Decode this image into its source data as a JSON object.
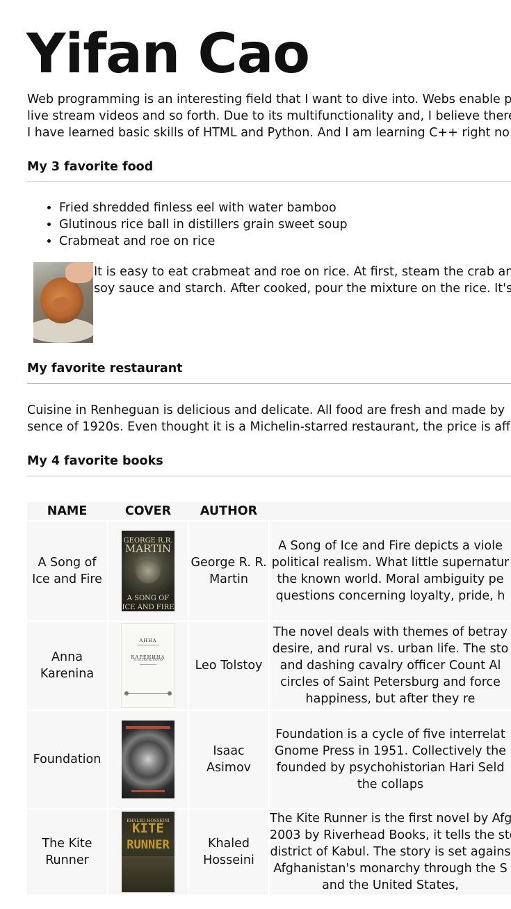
{
  "title": "Yifan Cao",
  "intro": [
    "Web programming is an interesting field that I want to dive into. Webs enable p",
    "live stream videos and so forth. Due to its multifunctionality and, I believe there",
    "I have learned basic skills of HTML and Python. And I am learning C++ right no"
  ],
  "food": {
    "heading": "My 3 favorite food",
    "items": [
      "Fried shredded finless eel with water bamboo",
      "Glutinous rice ball in distillers grain sweet soup",
      "Crabmeat and roe on rice"
    ],
    "text": [
      "It is easy to eat crabmeat and roe on rice. At first, steam the crab and",
      "soy sauce and starch. After cooked, pour the mixture on the rice. It's"
    ]
  },
  "restaurant": {
    "heading": "My favorite restaurant",
    "text": [
      "Cuisine in Renheguan is delicious and delicate. All food are fresh and made by",
      "sence of 1920s. Even thought it is a Michelin-starred restaurant, the price is affo"
    ]
  },
  "books": {
    "heading": "My 4 favorite books",
    "columns": [
      "NAME",
      "COVER",
      "AUTHOR"
    ],
    "rows": [
      {
        "name": [
          "A Song of",
          "Ice and Fire"
        ],
        "author": [
          "George R. R.",
          "Martin"
        ],
        "cover_text": [
          "GEORGE R.R.",
          "MARTIN",
          "A SONG OF",
          "ICE AND FIRE"
        ],
        "desc": [
          "A Song of Ice and Fire depicts a viole",
          "political realism. What little supernatur",
          "the known world. Moral ambiguity pe",
          "questions concerning loyalty, pride, h"
        ]
      },
      {
        "name": [
          "Anna",
          "Karenina"
        ],
        "author": [
          "Leo Tolstoy"
        ],
        "cover_text": [
          "АННА КАРЕНИНА",
          "Л.Н.ТОЛСТОГО"
        ],
        "desc": [
          "The novel deals with themes of betray",
          "desire, and rural vs. urban life. The sto",
          "and dashing cavalry officer Count Al",
          "circles of Saint Petersburg and force",
          "happiness, but after they re"
        ]
      },
      {
        "name": [
          "Foundation"
        ],
        "author": [
          "Isaac",
          "Asimov"
        ],
        "cover_text": [],
        "desc": [
          "Foundation is a cycle of five interrelat",
          "Gnome Press in 1951. Collectively the",
          "founded by psychohistorian Hari Seld",
          "the collaps"
        ]
      },
      {
        "name": [
          "The Kite",
          "Runner"
        ],
        "author": [
          "Khaled",
          "Hosseini"
        ],
        "cover_text": [
          "KHALED HOSSEINI",
          "KITE",
          "RUNNER"
        ],
        "desc": [
          "The Kite Runner is the first novel by Afg",
          "2003 by Riverhead Books, it tells the sto",
          "district of Kabul. The story is set agains",
          "Afghanistan's monarchy through the S",
          "and the United States,"
        ]
      }
    ]
  }
}
